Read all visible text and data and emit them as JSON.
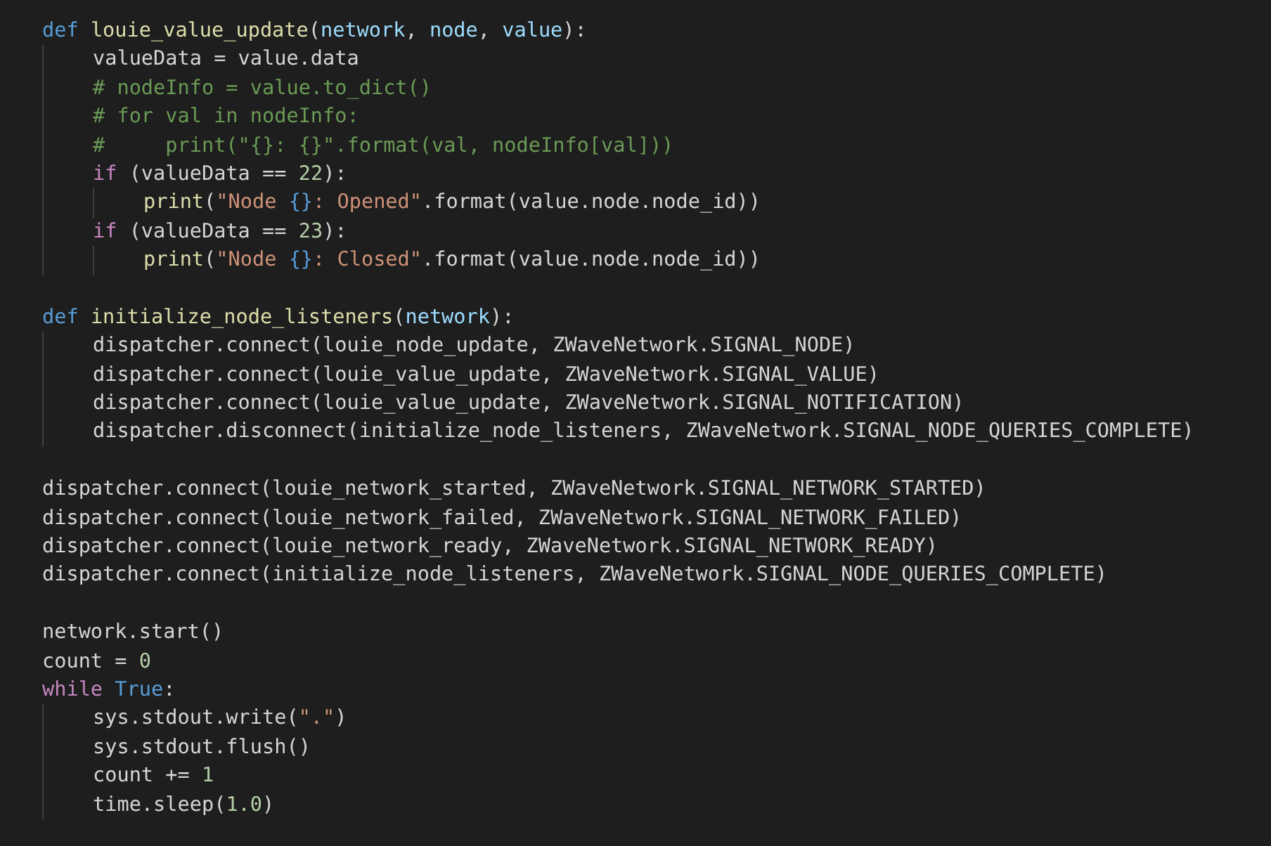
{
  "editor": {
    "lines": [
      {
        "kind": "code",
        "tokens": [
          {
            "kind": "kw",
            "text": "def "
          },
          {
            "kind": "fn",
            "text": "louie_value_update"
          },
          {
            "kind": "p",
            "text": "("
          },
          {
            "kind": "pa",
            "text": "network"
          },
          {
            "kind": "p",
            "text": ", "
          },
          {
            "kind": "pa",
            "text": "node"
          },
          {
            "kind": "p",
            "text": ", "
          },
          {
            "kind": "pa",
            "text": "value"
          },
          {
            "kind": "p",
            "text": "):"
          }
        ],
        "children": [
          {
            "kind": "code",
            "tokens": [
              {
                "kind": "p",
                "text": "valueData = value.data"
              }
            ]
          },
          {
            "kind": "code",
            "tokens": [
              {
                "kind": "c",
                "text": "# nodeInfo = value.to_dict()"
              }
            ]
          },
          {
            "kind": "code",
            "tokens": [
              {
                "kind": "c",
                "text": "# for val in nodeInfo:"
              }
            ]
          },
          {
            "kind": "code",
            "tokens": [
              {
                "kind": "c",
                "text": "#     print(\"{}: {}\".format(val, nodeInfo[val]))"
              }
            ]
          },
          {
            "kind": "code",
            "tokens": [
              {
                "kind": "ctl",
                "text": "if"
              },
              {
                "kind": "p",
                "text": " (valueData == "
              },
              {
                "kind": "n",
                "text": "22"
              },
              {
                "kind": "p",
                "text": "):"
              }
            ],
            "children": [
              {
                "kind": "code",
                "tokens": [
                  {
                    "kind": "fn",
                    "text": "print"
                  },
                  {
                    "kind": "p",
                    "text": "("
                  },
                  {
                    "kind": "s",
                    "text": "\"Node "
                  },
                  {
                    "kind": "e",
                    "text": "{}"
                  },
                  {
                    "kind": "s",
                    "text": ": Opened\""
                  },
                  {
                    "kind": "p",
                    "text": ".format(value.node.node_id))"
                  }
                ]
              }
            ]
          },
          {
            "kind": "code",
            "tokens": [
              {
                "kind": "ctl",
                "text": "if"
              },
              {
                "kind": "p",
                "text": " (valueData == "
              },
              {
                "kind": "n",
                "text": "23"
              },
              {
                "kind": "p",
                "text": "):"
              }
            ],
            "children": [
              {
                "kind": "code",
                "tokens": [
                  {
                    "kind": "fn",
                    "text": "print"
                  },
                  {
                    "kind": "p",
                    "text": "("
                  },
                  {
                    "kind": "s",
                    "text": "\"Node "
                  },
                  {
                    "kind": "e",
                    "text": "{}"
                  },
                  {
                    "kind": "s",
                    "text": ": Closed\""
                  },
                  {
                    "kind": "p",
                    "text": ".format(value.node.node_id))"
                  }
                ]
              }
            ]
          }
        ]
      },
      {
        "kind": "blank"
      },
      {
        "kind": "code",
        "tokens": [
          {
            "kind": "kw",
            "text": "def "
          },
          {
            "kind": "fn",
            "text": "initialize_node_listeners"
          },
          {
            "kind": "p",
            "text": "("
          },
          {
            "kind": "pa",
            "text": "network"
          },
          {
            "kind": "p",
            "text": "):"
          }
        ],
        "children": [
          {
            "kind": "code",
            "tokens": [
              {
                "kind": "p",
                "text": "dispatcher.connect(louie_node_update, ZWaveNetwork.SIGNAL_NODE)"
              }
            ]
          },
          {
            "kind": "code",
            "tokens": [
              {
                "kind": "p",
                "text": "dispatcher.connect(louie_value_update, ZWaveNetwork.SIGNAL_VALUE)"
              }
            ]
          },
          {
            "kind": "code",
            "tokens": [
              {
                "kind": "p",
                "text": "dispatcher.connect(louie_value_update, ZWaveNetwork.SIGNAL_NOTIFICATION)"
              }
            ]
          },
          {
            "kind": "code",
            "tokens": [
              {
                "kind": "p",
                "text": "dispatcher.disconnect(initialize_node_listeners, ZWaveNetwork.SIGNAL_NODE_QUERIES_COMPLETE)"
              }
            ]
          }
        ]
      },
      {
        "kind": "blank"
      },
      {
        "kind": "code",
        "tokens": [
          {
            "kind": "p",
            "text": "dispatcher.connect(louie_network_started, ZWaveNetwork.SIGNAL_NETWORK_STARTED)"
          }
        ]
      },
      {
        "kind": "code",
        "tokens": [
          {
            "kind": "p",
            "text": "dispatcher.connect(louie_network_failed, ZWaveNetwork.SIGNAL_NETWORK_FAILED)"
          }
        ]
      },
      {
        "kind": "code",
        "tokens": [
          {
            "kind": "p",
            "text": "dispatcher.connect(louie_network_ready, ZWaveNetwork.SIGNAL_NETWORK_READY)"
          }
        ]
      },
      {
        "kind": "code",
        "tokens": [
          {
            "kind": "p",
            "text": "dispatcher.connect(initialize_node_listeners, ZWaveNetwork.SIGNAL_NODE_QUERIES_COMPLETE)"
          }
        ]
      },
      {
        "kind": "blank"
      },
      {
        "kind": "code",
        "tokens": [
          {
            "kind": "p",
            "text": "network.start()"
          }
        ]
      },
      {
        "kind": "code",
        "tokens": [
          {
            "kind": "p",
            "text": "count = "
          },
          {
            "kind": "n",
            "text": "0"
          }
        ]
      },
      {
        "kind": "code",
        "tokens": [
          {
            "kind": "ctl",
            "text": "while "
          },
          {
            "kind": "kw",
            "text": "True"
          },
          {
            "kind": "p",
            "text": ":"
          }
        ],
        "children": [
          {
            "kind": "code",
            "tokens": [
              {
                "kind": "p",
                "text": "sys.stdout.write("
              },
              {
                "kind": "s",
                "text": "\".\""
              },
              {
                "kind": "p",
                "text": ")"
              }
            ]
          },
          {
            "kind": "code",
            "tokens": [
              {
                "kind": "p",
                "text": "sys.stdout.flush()"
              }
            ]
          },
          {
            "kind": "code",
            "tokens": [
              {
                "kind": "p",
                "text": "count += "
              },
              {
                "kind": "n",
                "text": "1"
              }
            ]
          },
          {
            "kind": "code",
            "tokens": [
              {
                "kind": "p",
                "text": "time.sleep("
              },
              {
                "kind": "n",
                "text": "1.0"
              },
              {
                "kind": "p",
                "text": ")"
              }
            ]
          }
        ]
      }
    ]
  }
}
